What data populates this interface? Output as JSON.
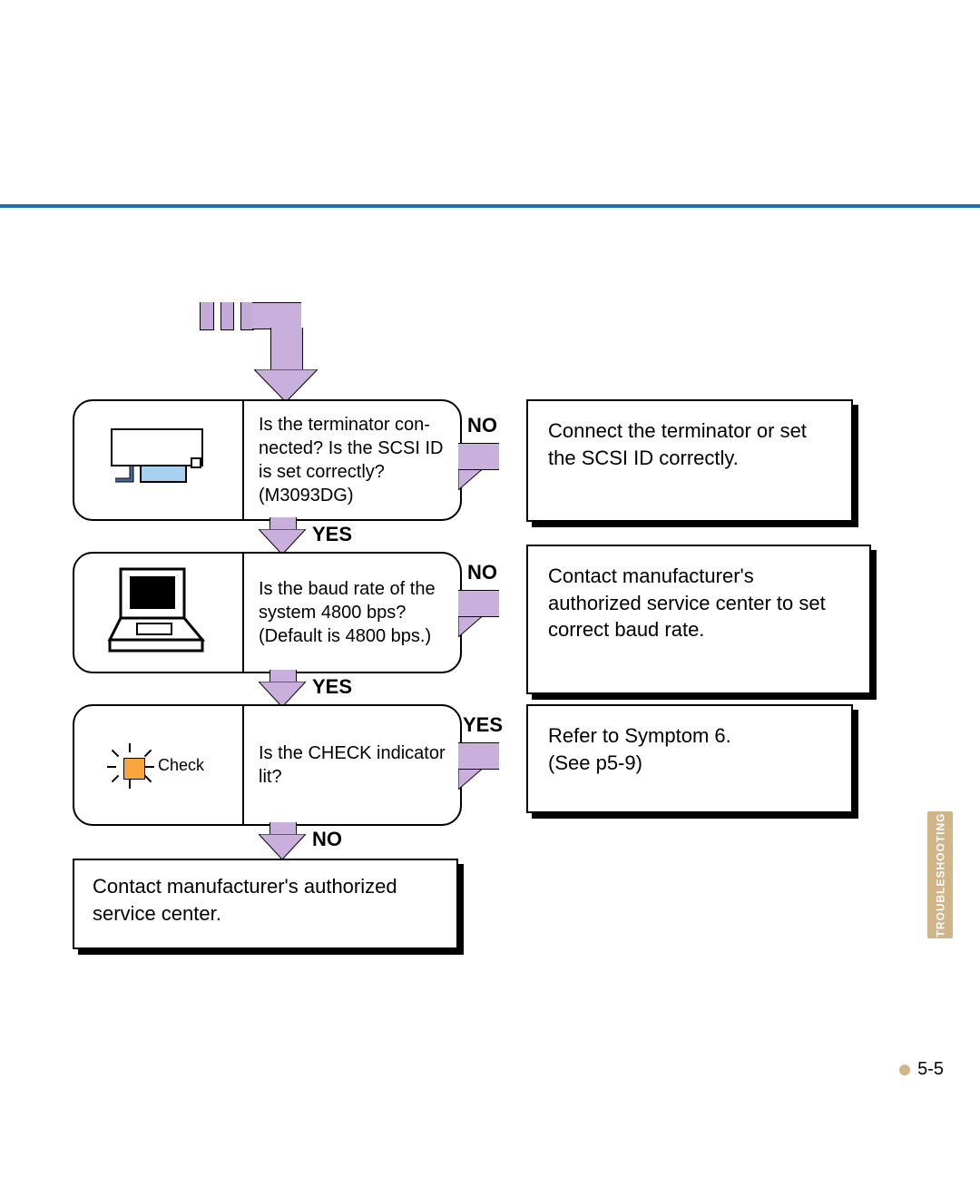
{
  "labels": {
    "yes": "YES",
    "no": "NO"
  },
  "step1": {
    "question_l1": "Is the terminator con-",
    "question_l2": "nected?  Is the SCSI ID",
    "question_l3": "is set correctly?",
    "question_l4": "(M3093DG)",
    "result": "Connect the terminator or set the SCSI ID correctly."
  },
  "step2": {
    "question_l1": "Is the baud rate of the",
    "question_l2": "system 4800 bps?",
    "question_l3": "(Default is 4800 bps.)",
    "result": "Contact manufacturer's authorized service center to set correct baud rate."
  },
  "step3": {
    "icon_label": "Check",
    "question_l1": "Is the CHECK indicator",
    "question_l2": "lit?",
    "result_l1": "Refer to Symptom 6.",
    "result_l2": "(See p5-9)"
  },
  "final": "Contact manufacturer's authorized service center.",
  "side_tab": "TROUBLESHOOTING",
  "page_number": "5-5"
}
